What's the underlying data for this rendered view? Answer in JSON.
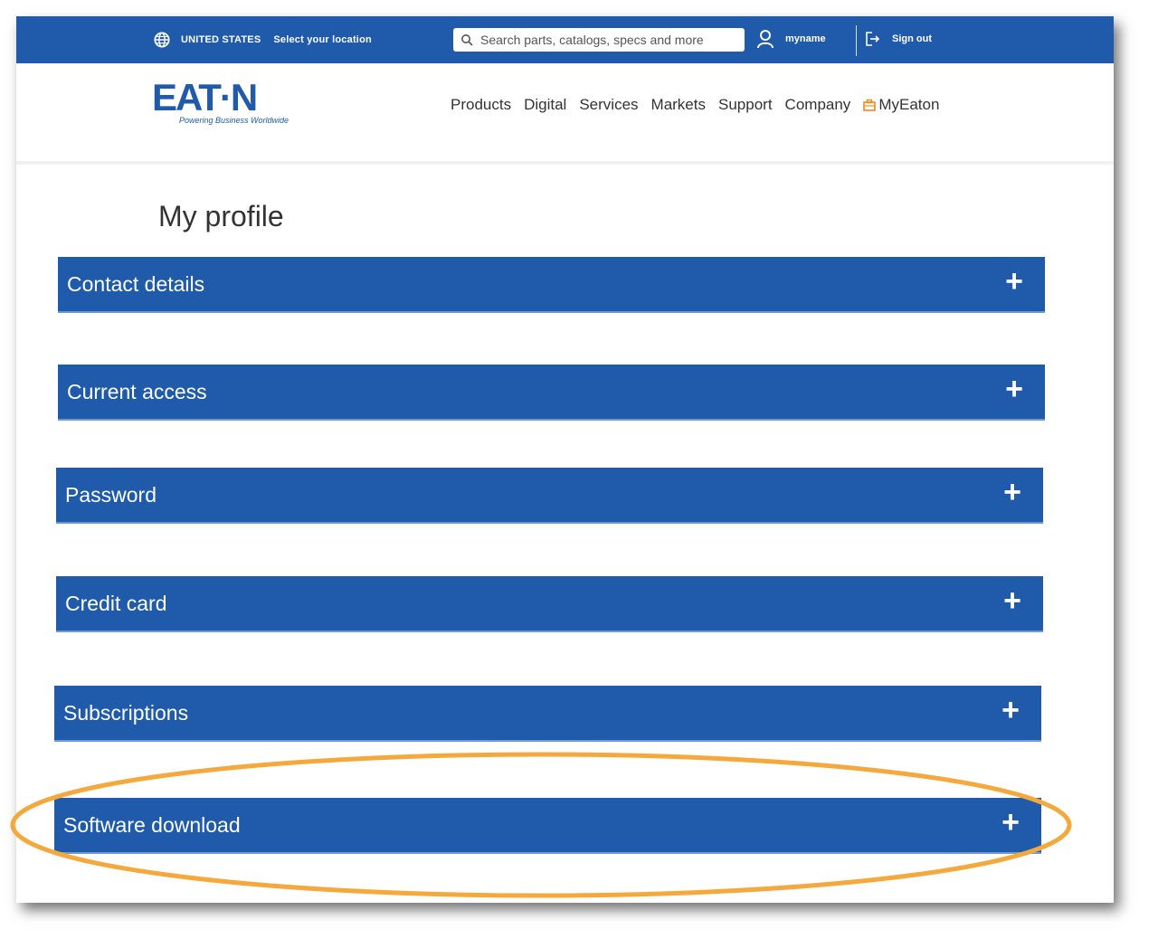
{
  "topbar": {
    "country": "UNITED STATES",
    "select_location": "Select your location",
    "search_placeholder": "Search parts, catalogs, specs and more",
    "username": "myname",
    "sign_out": "Sign out"
  },
  "header": {
    "logo_text": "EAT·N",
    "tagline": "Powering Business Worldwide",
    "nav": [
      "Products",
      "Digital",
      "Services",
      "Markets",
      "Support",
      "Company",
      "MyEaton"
    ]
  },
  "main": {
    "title": "My profile",
    "panels": [
      {
        "label": "Contact details",
        "icon": "plus-icon"
      },
      {
        "label": "Current access",
        "icon": "plus-icon"
      },
      {
        "label": "Password",
        "icon": "plus-icon"
      },
      {
        "label": "Credit card",
        "icon": "plus-icon"
      },
      {
        "label": "Subscriptions",
        "icon": "plus-icon"
      },
      {
        "label": "Software download",
        "icon": "plus-icon"
      }
    ],
    "plus_symbol": "+"
  },
  "colors": {
    "brand_blue": "#1f5baa",
    "highlight_orange": "#f5a93d",
    "myeaton_orange": "#f08a1c"
  }
}
